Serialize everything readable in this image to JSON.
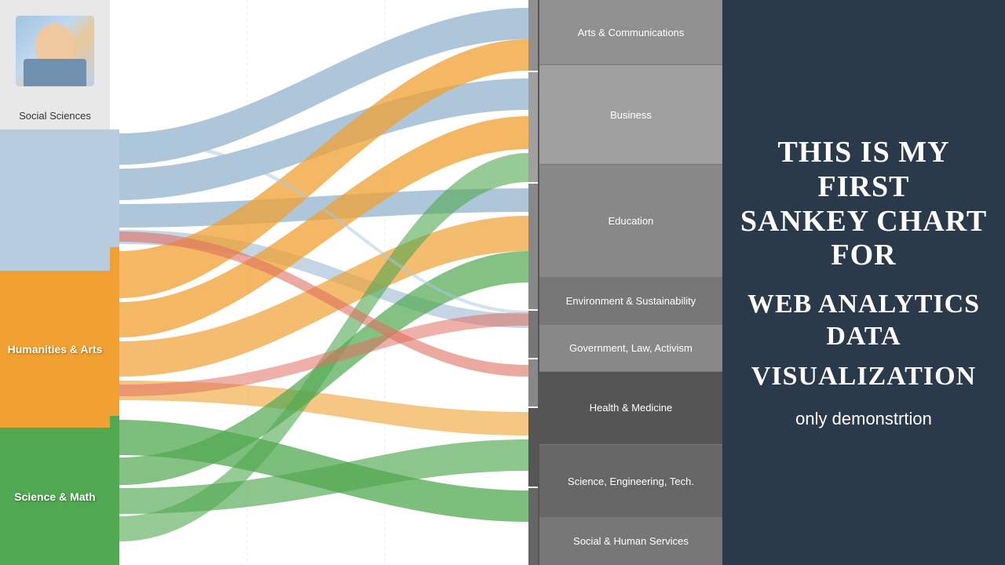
{
  "sidebar": {
    "avatar_label": "Social Sciences",
    "sections": [
      {
        "id": "social-sciences",
        "label": "Social Sciences",
        "color": "#b8cce0"
      },
      {
        "id": "humanities-arts",
        "label": "Humanities & Arts",
        "color": "#f0a030"
      },
      {
        "id": "science-math",
        "label": "Science & Math",
        "color": "#50a850"
      }
    ]
  },
  "categories": [
    {
      "id": "arts-communications",
      "label": "Arts & Communications",
      "color": "#909090"
    },
    {
      "id": "business",
      "label": "Business",
      "color": "#a0a0a0"
    },
    {
      "id": "education",
      "label": "Education",
      "color": "#888888"
    },
    {
      "id": "environment-sustainability",
      "label": "Environment & Sustainability",
      "color": "#777777"
    },
    {
      "id": "government-law-activism",
      "label": "Government, Law, Activism",
      "color": "#888888"
    },
    {
      "id": "health-medicine",
      "label": "Health & Medicine",
      "color": "#555555"
    },
    {
      "id": "science-engineering-tech",
      "label": "Science, Engineering, Tech.",
      "color": "#666666"
    },
    {
      "id": "social-human-services",
      "label": "Social & Human Services",
      "color": "#777777"
    }
  ],
  "title": {
    "line1": "This is my first",
    "line2": "Sankey Chart",
    "line3": "for",
    "line4": "Web Analytics",
    "line5": "Data",
    "line6": "Visualization",
    "line7": "only demonstrtion"
  },
  "chart": {
    "colors": {
      "blue": "#8aaecb",
      "orange": "#f0a030",
      "green": "#50a850",
      "red": "#e07060",
      "lightblue": "#a8c8e0"
    }
  }
}
